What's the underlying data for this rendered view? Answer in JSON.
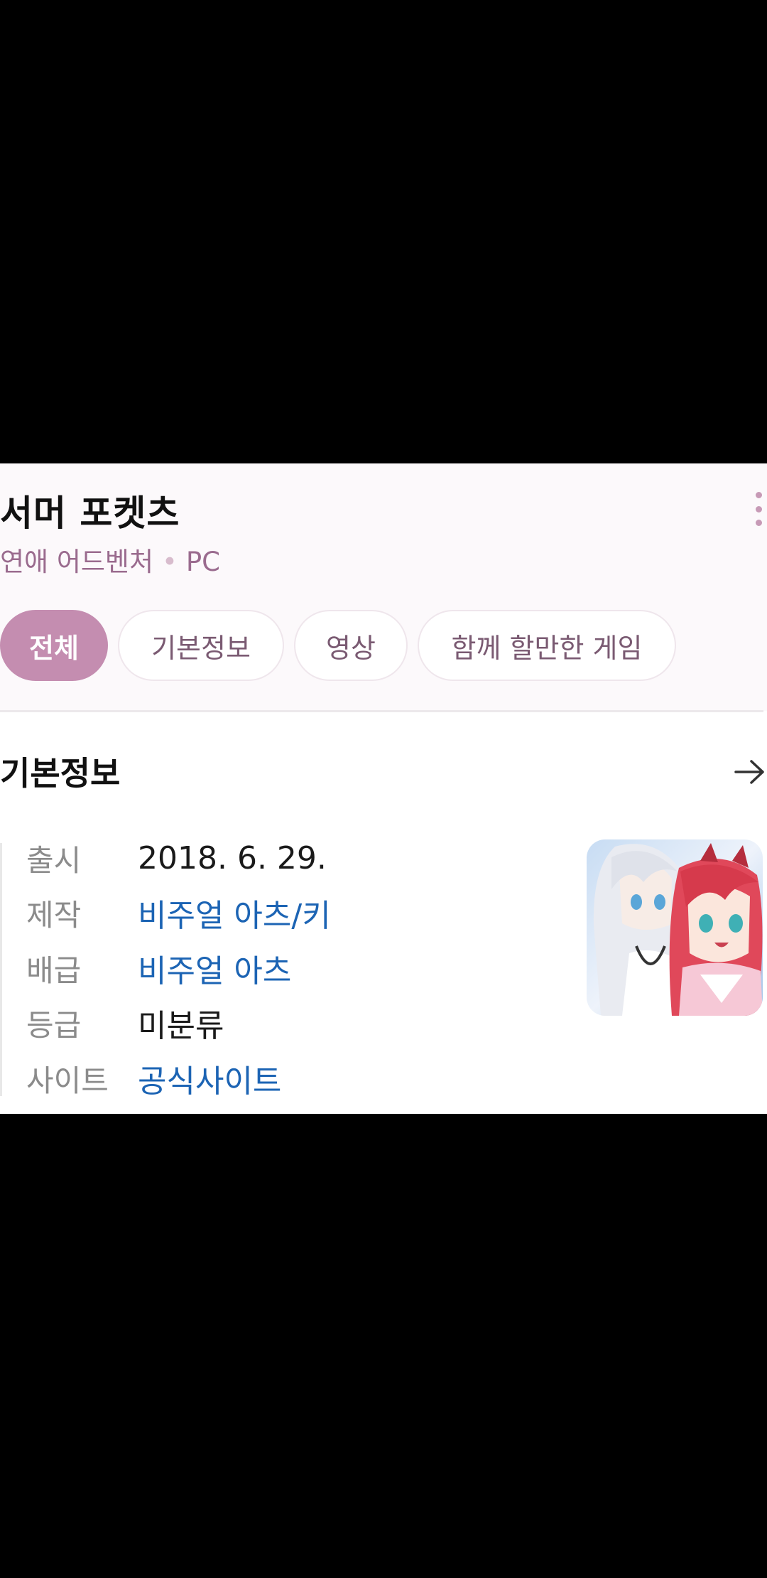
{
  "game": {
    "title": "서머 포켓츠",
    "genre": "연애 어드벤처",
    "separator": "•",
    "platform": "PC"
  },
  "tabs": [
    {
      "label": "전체",
      "active": true
    },
    {
      "label": "기본정보",
      "active": false
    },
    {
      "label": "영상",
      "active": false
    },
    {
      "label": "함께 할만한 게임",
      "active": false
    }
  ],
  "section": {
    "title": "기본정보"
  },
  "info": [
    {
      "label": "출시",
      "value": "2018. 6. 29.",
      "link": false
    },
    {
      "label": "제작",
      "value": "비주얼 아츠/키",
      "link": true
    },
    {
      "label": "배급",
      "value": "비주얼 아츠",
      "link": true
    },
    {
      "label": "등급",
      "value": "미분류",
      "link": false
    },
    {
      "label": "사이트",
      "value": "공식사이트",
      "link": true
    }
  ],
  "icons": {
    "more": "more-vertical-icon",
    "arrow": "arrow-right-icon"
  },
  "colors": {
    "accent": "#c48db0",
    "subtitle": "#9a6b8e",
    "link": "#1c64b4",
    "header_bg": "#fcf9fb"
  }
}
